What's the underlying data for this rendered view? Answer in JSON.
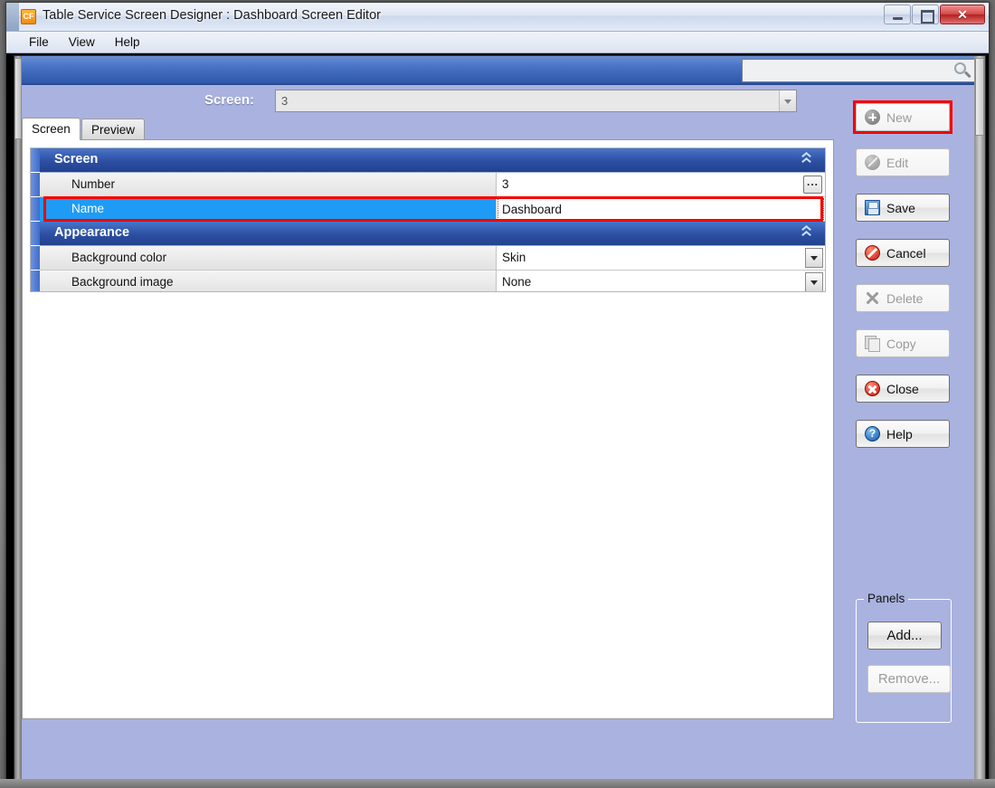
{
  "window": {
    "app_icon_text": "CF",
    "title": "Table Service Screen Designer : Dashboard Screen Editor",
    "controls": {
      "minimize": "minimize-icon",
      "maximize": "maximize-icon",
      "close": "✕"
    }
  },
  "menu": {
    "items": [
      {
        "label": "File"
      },
      {
        "label": "View"
      },
      {
        "label": "Help"
      }
    ]
  },
  "search": {
    "value": "",
    "placeholder": "",
    "icon": "search-icon"
  },
  "screen_selector": {
    "label": "Screen:",
    "value": "3",
    "arrow_icon": "chevron-down-icon"
  },
  "tabs": [
    {
      "label": "Screen",
      "active": true
    },
    {
      "label": "Preview",
      "active": false
    }
  ],
  "property_grid": {
    "groups": [
      {
        "title": "Screen",
        "collapse_icon": "chevron-double-up-icon",
        "rows": [
          {
            "name": "Number",
            "value": "3",
            "editor": "ellipsis",
            "editor_label": "...",
            "selected": false
          },
          {
            "name": "Name",
            "value": "Dashboard",
            "editor": "textbox",
            "selected": true,
            "highlighted": true
          }
        ]
      },
      {
        "title": "Appearance",
        "collapse_icon": "chevron-double-up-icon",
        "rows": [
          {
            "name": "Background color",
            "value": "Skin",
            "editor": "dropdown",
            "selected": false
          },
          {
            "name": "Background image",
            "value": "None",
            "editor": "dropdown",
            "selected": false
          }
        ]
      }
    ]
  },
  "action_buttons": [
    {
      "label": "New",
      "icon": "plus-circle-icon",
      "enabled": false,
      "highlighted": true
    },
    {
      "label": "Edit",
      "icon": "pencil-circle-icon",
      "enabled": false,
      "highlighted": false
    },
    {
      "label": "Save",
      "icon": "floppy-disk-icon",
      "enabled": true,
      "highlighted": false
    },
    {
      "label": "Cancel",
      "icon": "no-entry-icon",
      "enabled": true,
      "highlighted": false
    },
    {
      "label": "Delete",
      "icon": "x-mark-icon",
      "enabled": false,
      "highlighted": false
    },
    {
      "label": "Copy",
      "icon": "copy-pages-icon",
      "enabled": false,
      "highlighted": false
    },
    {
      "label": "Close",
      "icon": "close-circle-icon",
      "enabled": true,
      "highlighted": false
    },
    {
      "label": "Help",
      "icon": "question-circle-icon",
      "enabled": true,
      "highlighted": false,
      "glyph": "?"
    }
  ],
  "panels_group": {
    "legend": "Panels",
    "add_label": "Add...",
    "remove_label": "Remove...",
    "add_enabled": true,
    "remove_enabled": false
  },
  "colors": {
    "window_background": "#aab2e0",
    "toolbar_blue_top": "#6b8fd6",
    "toolbar_blue_bottom": "#27488f",
    "group_header_blue": "#2c4fa2",
    "selected_row_blue": "#1e9bf5",
    "annotation_red": "#f40000",
    "title_icon_orange": "#f08a10"
  }
}
